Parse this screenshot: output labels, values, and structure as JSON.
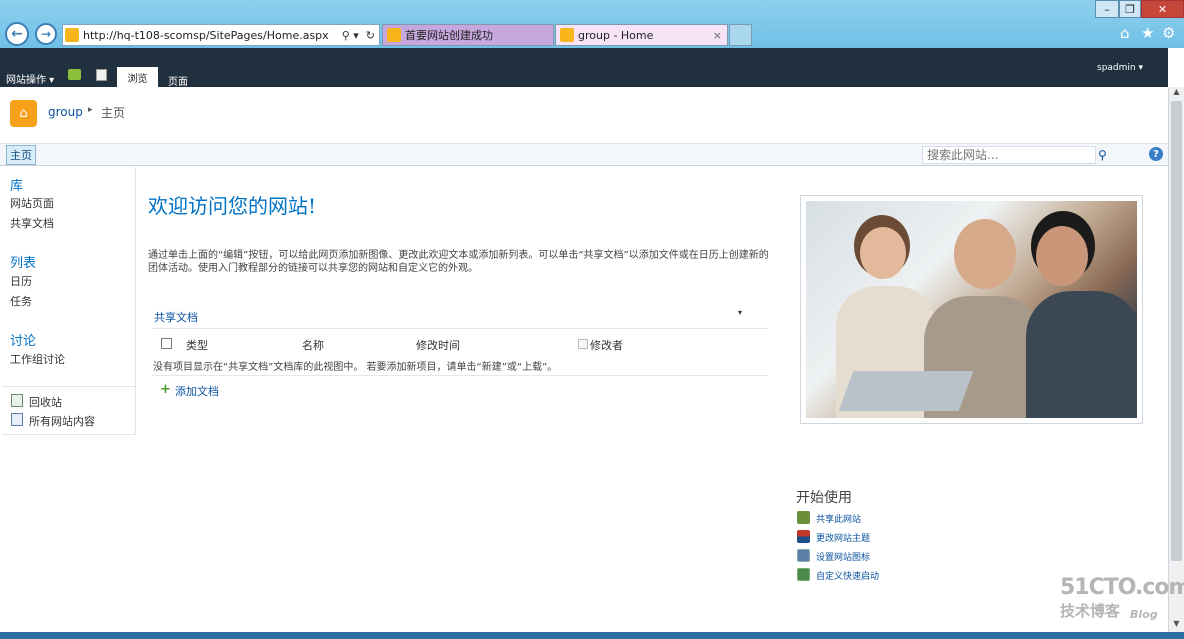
{
  "browser": {
    "url": "http://hq-t108-scomsp/SitePages/Home.aspx",
    "tabs": [
      {
        "label": "首要网站创建成功"
      },
      {
        "label": "group - Home"
      }
    ],
    "tab_close": "×",
    "search_glyph": "⚲ ▾",
    "refresh_glyph": "↻"
  },
  "window": {
    "minimize": "–",
    "restore": "❐",
    "close": "✕"
  },
  "ribbon": {
    "site_actions": "网站操作",
    "browse_tab": "浏览",
    "page_tab": "页面",
    "user": "spadmin"
  },
  "header": {
    "site_name": "group",
    "separator": "▸",
    "current_page": "主页"
  },
  "topnav": {
    "home_tab": "主页",
    "search_placeholder": "搜索此网站..."
  },
  "quicklaunch": {
    "sections": [
      {
        "heading": "库",
        "items": [
          "网站页面",
          "共享文档"
        ]
      },
      {
        "heading": "列表",
        "items": [
          "日历",
          "任务"
        ]
      },
      {
        "heading": "讨论",
        "items": [
          "工作组讨论"
        ]
      }
    ],
    "recycle_bin": "回收站",
    "all_content": "所有网站内容"
  },
  "main": {
    "title": "欢迎访问您的网站!",
    "intro": "通过单击上面的“编辑”按钮，可以给此网页添加新图像、更改此欢迎文本或添加新列表。可以单击“共享文档”以添加文件或在日历上创建新的团体活动。使用入门教程部分的链接可以共享您的网站和自定义它的外观。",
    "library": {
      "title": "共享文档",
      "columns": [
        "类型",
        "名称",
        "修改时间",
        "修改者"
      ],
      "empty_message": "没有项目显示在“共享文档”文档库的此视图中。 若要添加新项目，请单击“新建”或“上载”。",
      "add_link": "添加文档"
    }
  },
  "getting_started": {
    "heading": "开始使用",
    "links": [
      {
        "label": "共享此网站",
        "color": "#6b8e3a"
      },
      {
        "label": "更改网站主题",
        "color": "#c0392b"
      },
      {
        "label": "设置网站图标",
        "color": "#5b7fa8"
      },
      {
        "label": "自定义快速启动",
        "color": "#4a8a4a"
      }
    ]
  },
  "watermark": {
    "line1": "51CTO.com",
    "line2": "技术博客",
    "line3": "Blog"
  }
}
